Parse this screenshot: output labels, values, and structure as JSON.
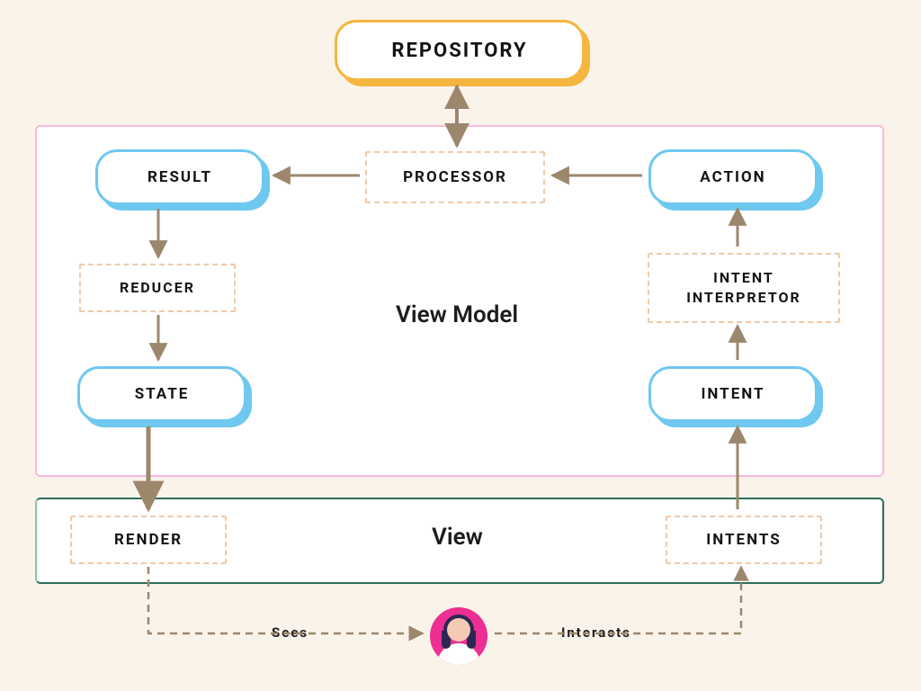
{
  "nodes": {
    "repository": "REPOSITORY",
    "processor": "PROCESSOR",
    "result": "RESULT",
    "action": "ACTION",
    "reducer": "REDUCER",
    "intent_interpretor": "INTENT\nINTERPRETOR",
    "state": "STATE",
    "intent": "INTENT",
    "render": "RENDER",
    "intents": "INTENTS"
  },
  "sections": {
    "view_model": "View Model",
    "view": "View"
  },
  "edges": {
    "sees": "Sees",
    "interacts": "Interacts"
  },
  "colors": {
    "bg": "#faf3ea",
    "orange": "#f4b63f",
    "blue": "#6fc8ef",
    "dash": "#f0c9a8",
    "arrow": "#9c876d",
    "pink": "#f7b9dc",
    "green": "#2d6f5a",
    "avatar": "#ec2f92"
  }
}
